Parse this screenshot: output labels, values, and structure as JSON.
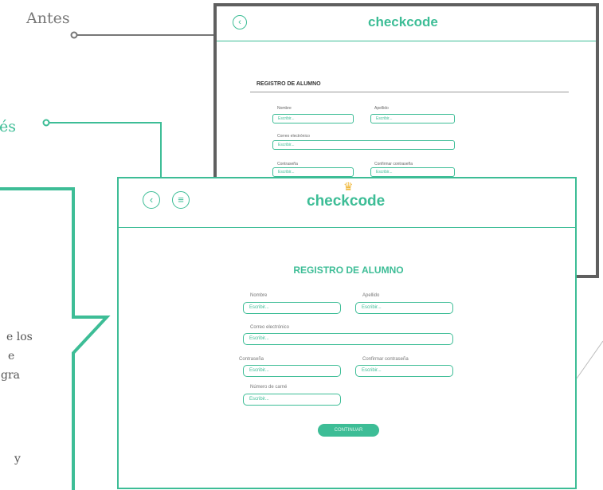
{
  "annotations": {
    "before": "Antes",
    "after": "és",
    "callout_lines": [
      "e los",
      "e",
      "gra",
      "y"
    ]
  },
  "old_screen": {
    "logo": "checkcode",
    "back_icon": "back-icon",
    "title": "REGISTRO DE ALUMNO",
    "fields": {
      "first_name_label": "Nombre",
      "last_name_label": "Apellido",
      "email_label": "Correo electrónico",
      "password_label": "Contraseña",
      "confirm_label": "Confirmar  contraseña",
      "placeholder": "Escribir..."
    }
  },
  "new_screen": {
    "logo": "checkcode",
    "title": "REGISTRO DE ALUMNO",
    "fields": {
      "first_name_label": "Nombre",
      "last_name_label": "Apellido",
      "email_label": "Correo electrónico",
      "password_label": "Contraseña",
      "confirm_label": "Confirmar  contraseña",
      "card_label": "Número de carné",
      "placeholder": "Escribir..."
    },
    "continue_label": "CONTINUAR"
  },
  "colors": {
    "accent": "#3dbd96",
    "frame": "#5f5f5f",
    "crown": "#f0b533"
  }
}
